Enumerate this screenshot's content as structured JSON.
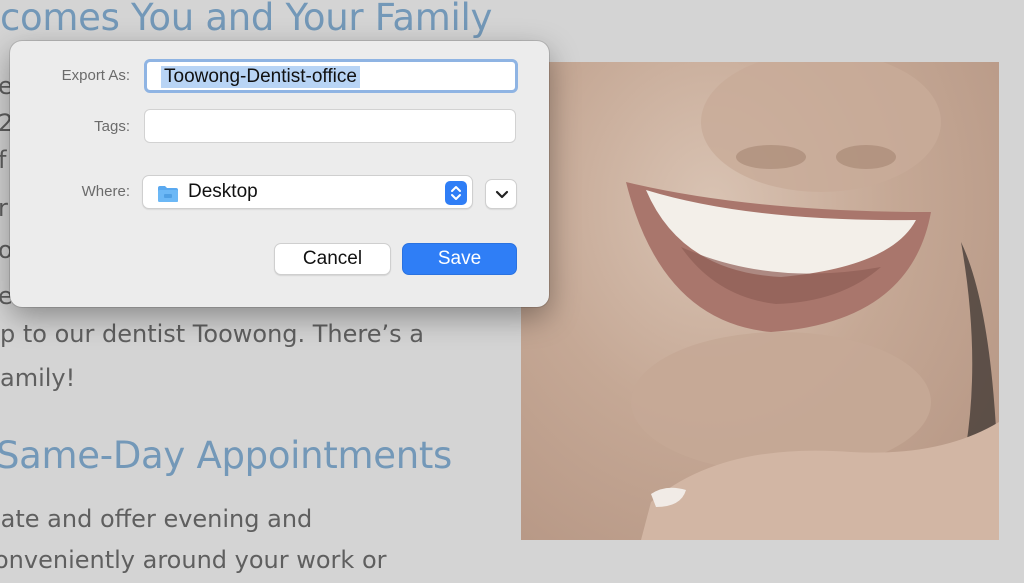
{
  "background": {
    "heading_top": "comes You and Your Family",
    "heading_mid": "Same-Day Appointments",
    "line_a": "p to our dentist Toowong. There’s a",
    "line_b": "amily!",
    "line_c": "late and offer evening and",
    "line_d": "onveniently around your work or",
    "fragments": [
      "e",
      "2",
      "f",
      "r",
      "o",
      "e"
    ],
    "colors": {
      "heading": "#7398b8",
      "text": "#5f5f5f"
    }
  },
  "dialog": {
    "export_as_label": "Export As:",
    "export_as_value": "Toowong-Dentist-office",
    "tags_label": "Tags:",
    "tags_value": "",
    "where_label": "Where:",
    "where_value": "Desktop",
    "where_icon": "folder-icon",
    "cancel_label": "Cancel",
    "save_label": "Save",
    "accent_color": "#2f7ef6"
  }
}
